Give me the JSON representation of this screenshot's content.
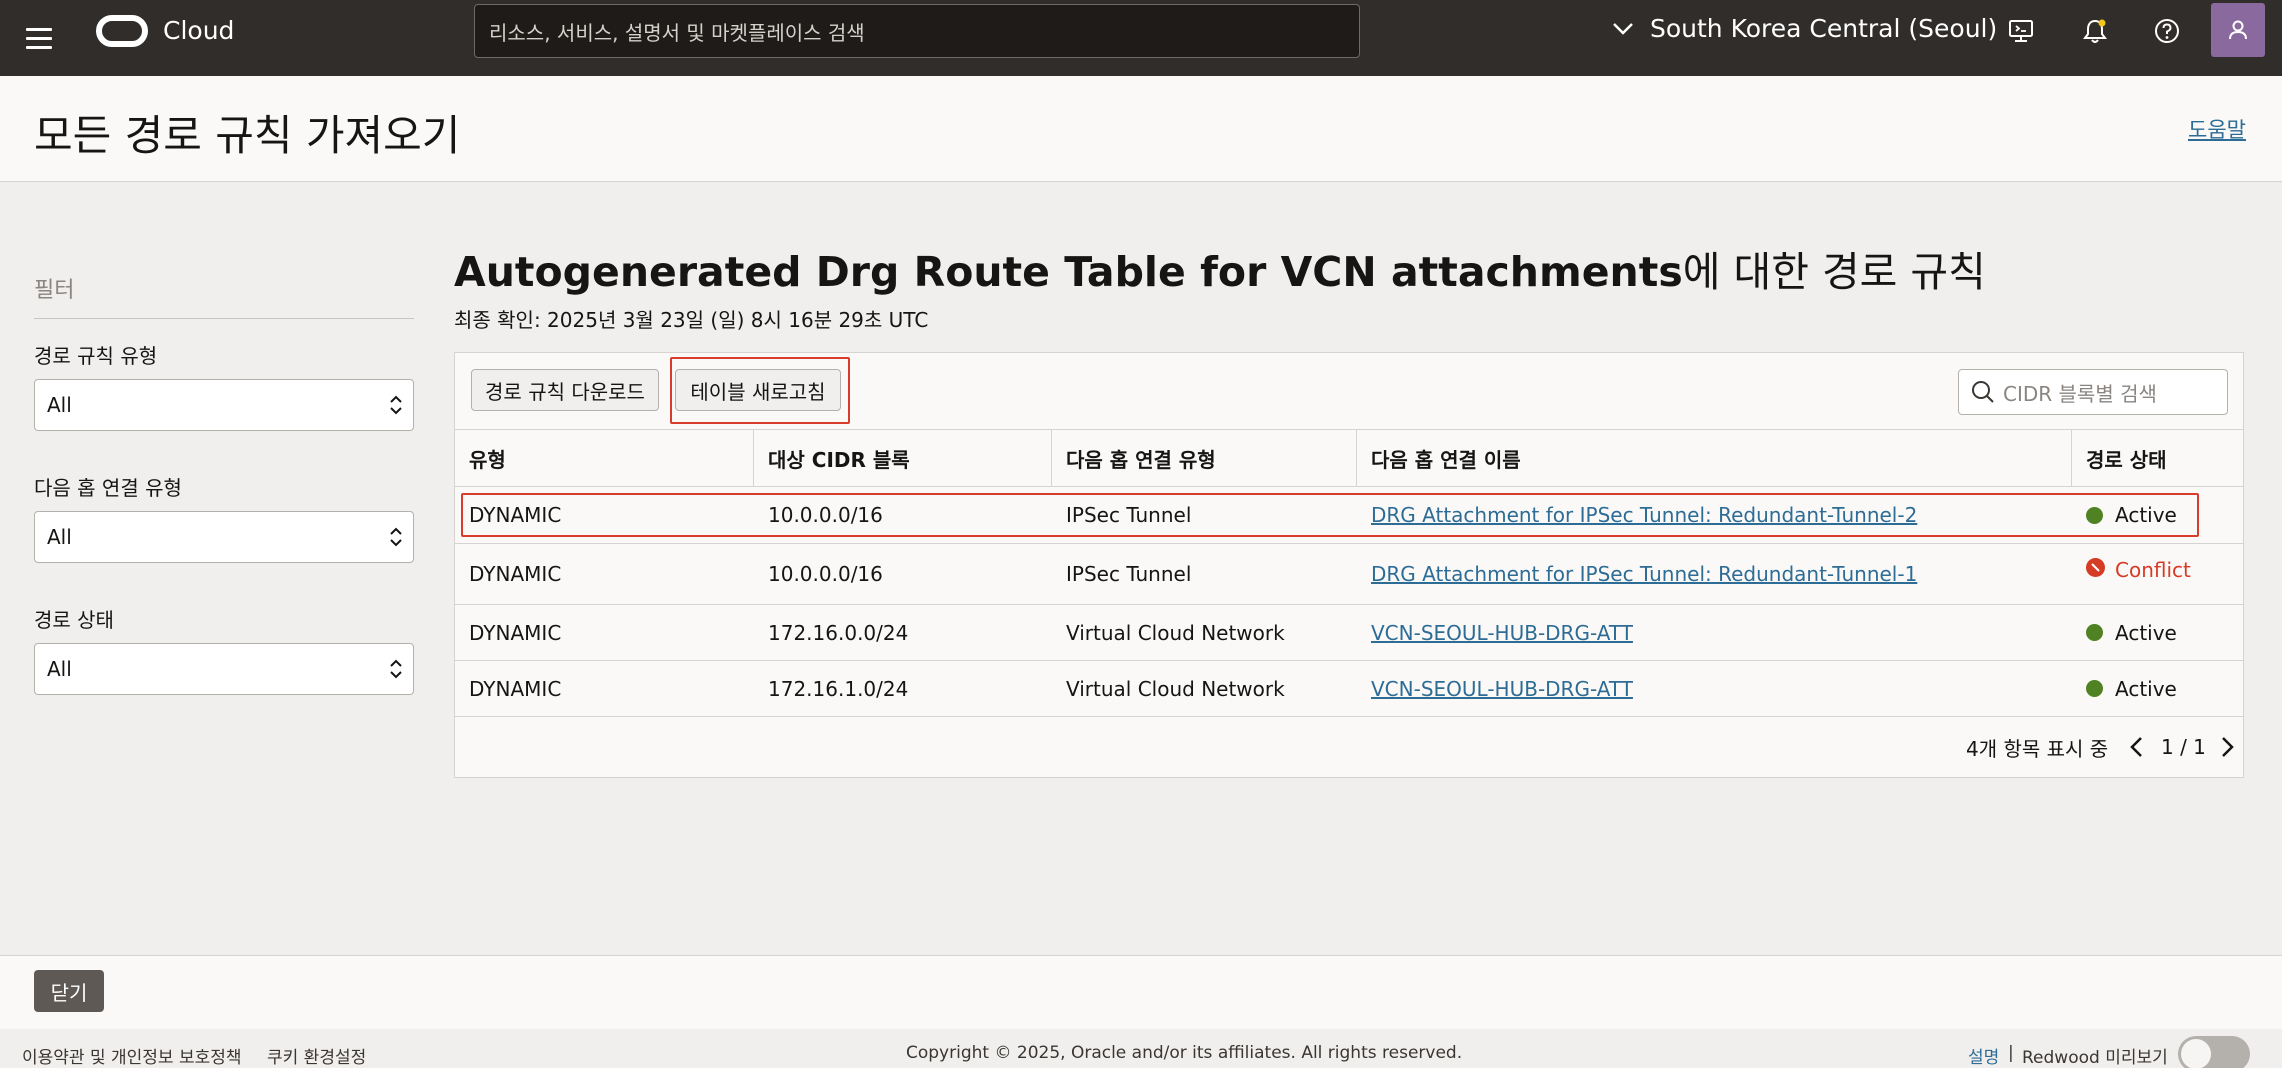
{
  "header": {
    "brand": "Cloud",
    "search_placeholder": "리소스, 서비스, 설명서 및 마켓플레이스 검색",
    "region": "South Korea Central (Seoul)",
    "icons": [
      "menu-icon",
      "cloud-shell-icon",
      "bell-icon",
      "help-icon",
      "profile-icon"
    ]
  },
  "page": {
    "title": "모든 경로 규칙 가져오기",
    "help_link": "도움말"
  },
  "filters": {
    "title": "필터",
    "route_rule_type": {
      "label": "경로 규칙 유형",
      "value": "All"
    },
    "next_hop_type": {
      "label": "다음 홉 연결 유형",
      "value": "All"
    },
    "route_status": {
      "label": "경로 상태",
      "value": "All"
    }
  },
  "main": {
    "title_bold": "Autogenerated Drg Route Table for VCN attachments",
    "title_suffix": "에 대한 경로 규칙",
    "last_checked": "최종 확인: 2025년 3월 23일 (일) 8시 16분 29초 UTC",
    "download_button": "경로 규칙 다운로드",
    "refresh_button": "테이블 새로고침",
    "cidr_search_placeholder": "CIDR 블록별 검색"
  },
  "table": {
    "columns": [
      "유형",
      "대상 CIDR 블록",
      "다음 홉 연결 유형",
      "다음 홉 연결 이름",
      "경로 상태"
    ],
    "rows": [
      {
        "type": "DYNAMIC",
        "cidr": "10.0.0.0/16",
        "next_hop_type": "IPSec Tunnel",
        "next_hop_name": "DRG Attachment for IPSec Tunnel: Redundant-Tunnel-2",
        "status": "Active"
      },
      {
        "type": "DYNAMIC",
        "cidr": "10.0.0.0/16",
        "next_hop_type": "IPSec Tunnel",
        "next_hop_name": "DRG Attachment for IPSec Tunnel: Redundant-Tunnel-1",
        "status": "Conflict"
      },
      {
        "type": "DYNAMIC",
        "cidr": "172.16.0.0/24",
        "next_hop_type": "Virtual Cloud Network",
        "next_hop_name": "VCN-SEOUL-HUB-DRG-ATT",
        "status": "Active"
      },
      {
        "type": "DYNAMIC",
        "cidr": "172.16.1.0/24",
        "next_hop_type": "Virtual Cloud Network",
        "next_hop_name": "VCN-SEOUL-HUB-DRG-ATT",
        "status": "Active"
      }
    ],
    "count_text": "4개 항목 표시 중",
    "page_text": "1 / 1"
  },
  "actions": {
    "close_button": "닫기"
  },
  "footer": {
    "terms": "이용약관 및 개인정보 보호정책",
    "cookies": "쿠키 환경설정",
    "copyright": "Copyright © 2025, Oracle and/or its affiliates. All rights reserved.",
    "explain": "설명",
    "separator": "|",
    "redwood_preview": "Redwood 미리보기"
  },
  "colors": {
    "header_bg": "#312d2a",
    "link": "#2d6c95",
    "active_green": "#508223",
    "conflict_red": "#d63b25",
    "highlight_red": "#d73c2c"
  }
}
